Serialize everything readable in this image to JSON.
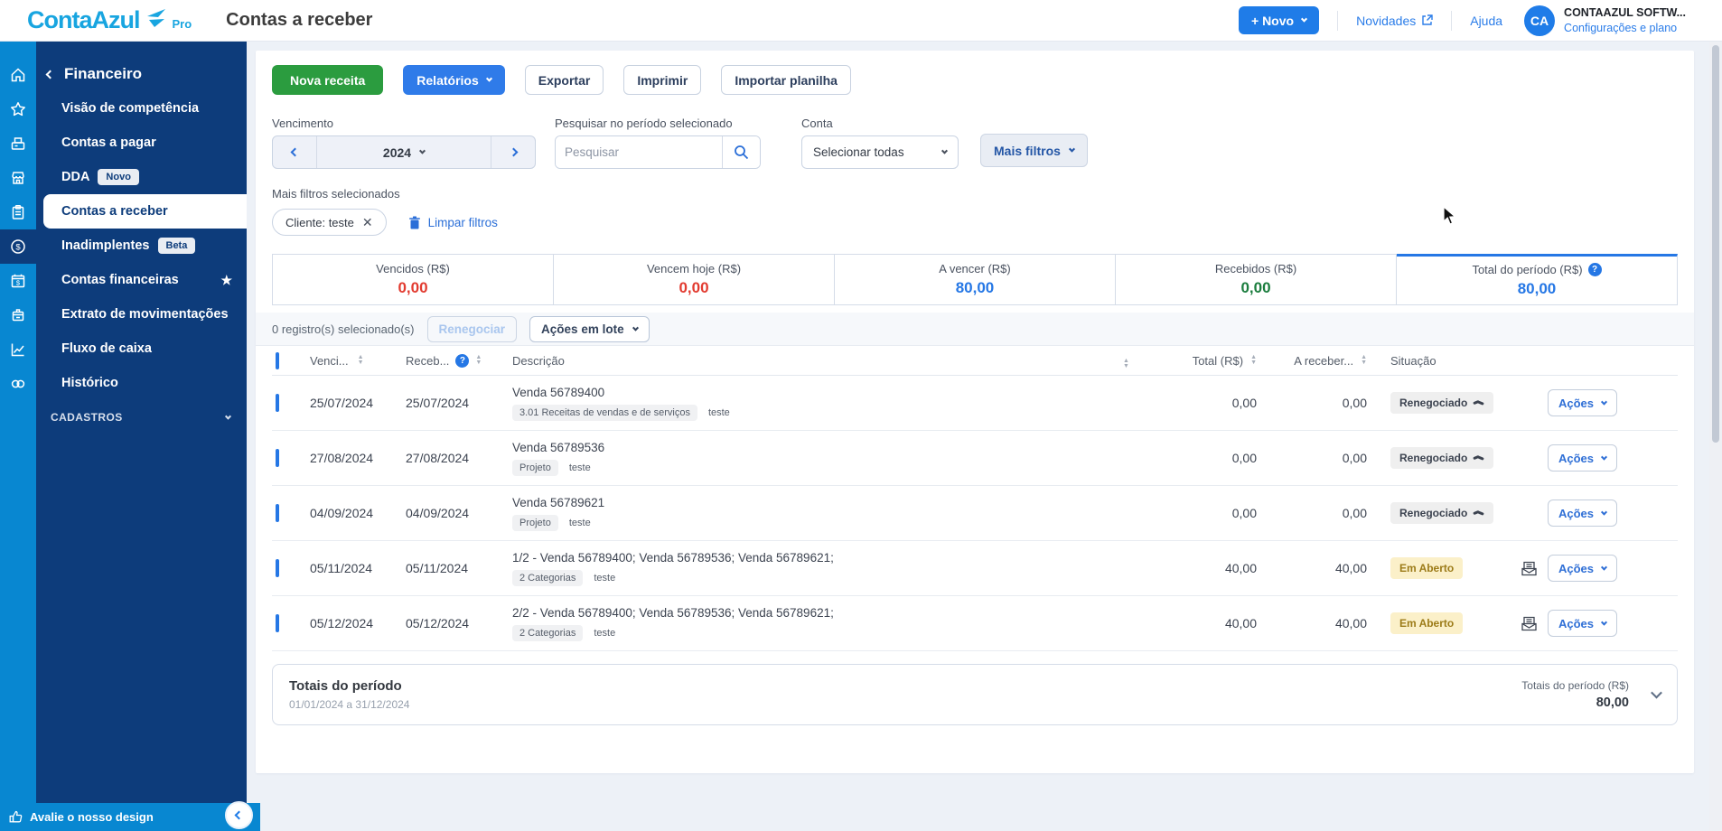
{
  "colors": {
    "brand_cyan": "#18a5e0",
    "rail_blue": "#0887d1",
    "sidebar_navy": "#0d3c7b",
    "accent_blue": "#1f7ce8",
    "green_button": "#2b9c3f",
    "value_red": "#e23b30",
    "value_blue": "#2577e5",
    "value_green": "#1b7d3e",
    "warning_badge_bg": "#fbf0c9"
  },
  "header": {
    "logo_text": "ContaAzul",
    "logo_pro": "Pro",
    "page_title": "Contas a receber",
    "novo_button": "+ Novo",
    "novidades_link": "Novidades",
    "ajuda_link": "Ajuda",
    "avatar_initials": "CA",
    "account_name": "CONTAAZUL SOFTW...",
    "account_settings": "Configurações e plano"
  },
  "sidebar": {
    "section_title": "Financeiro",
    "items": [
      {
        "label": "Visão de competência"
      },
      {
        "label": "Contas a pagar"
      },
      {
        "label": "DDA",
        "badge": "Novo"
      },
      {
        "label": "Contas a receber"
      },
      {
        "label": "Inadimplentes",
        "badge": "Beta"
      },
      {
        "label": "Contas financeiras"
      },
      {
        "label": "Extrato de movimentações"
      },
      {
        "label": "Fluxo de caixa"
      },
      {
        "label": "Histórico"
      }
    ],
    "section_footer": "CADASTROS",
    "rate_design": "Avalie o nosso design"
  },
  "toolbar": {
    "nova_receita": "Nova receita",
    "relatorios": "Relatórios",
    "exportar": "Exportar",
    "imprimir": "Imprimir",
    "importar_planilha": "Importar planilha"
  },
  "filters": {
    "vencimento_label": "Vencimento",
    "year_value": "2024",
    "search_label": "Pesquisar no período selecionado",
    "search_placeholder": "Pesquisar",
    "conta_label": "Conta",
    "conta_value": "Selecionar todas",
    "mais_filtros": "Mais filtros",
    "selected_label": "Mais filtros selecionados",
    "chip": "Cliente: teste",
    "limpar_filtros": "Limpar filtros"
  },
  "summary_cards": [
    {
      "label": "Vencidos (R$)",
      "value": "0,00",
      "color": "#e23b30"
    },
    {
      "label": "Vencem hoje (R$)",
      "value": "0,00",
      "color": "#e23b30"
    },
    {
      "label": "A vencer (R$)",
      "value": "80,00",
      "color": "#2577e5"
    },
    {
      "label": "Recebidos (R$)",
      "value": "0,00",
      "color": "#1b7d3e"
    },
    {
      "label": "Total do período (R$)",
      "value": "80,00",
      "color": "#2577e5"
    }
  ],
  "batch_bar": {
    "selected_text": "0 registro(s) selecionado(s)",
    "renegociar": "Renegociar",
    "acoes_em_lote": "Ações em lote"
  },
  "table": {
    "columns": {
      "venc": "Venci...",
      "receb": "Receb...",
      "descricao": "Descrição",
      "total": "Total (R$)",
      "a_receber": "A receber...",
      "situacao": "Situação"
    },
    "acoes_label": "Ações",
    "rows": [
      {
        "venc": "25/07/2024",
        "receb": "25/07/2024",
        "desc": "Venda 56789400",
        "tag": "3.01 Receitas de vendas e de serviços",
        "tag_extra": "teste",
        "total": "0,00",
        "a_receber": "0,00",
        "status": "Renegociado",
        "status_type": "renegociado",
        "boleto": false
      },
      {
        "venc": "27/08/2024",
        "receb": "27/08/2024",
        "desc": "Venda 56789536",
        "tag": "Projeto",
        "tag_extra": "teste",
        "total": "0,00",
        "a_receber": "0,00",
        "status": "Renegociado",
        "status_type": "renegociado",
        "boleto": false
      },
      {
        "venc": "04/09/2024",
        "receb": "04/09/2024",
        "desc": "Venda 56789621",
        "tag": "Projeto",
        "tag_extra": "teste",
        "total": "0,00",
        "a_receber": "0,00",
        "status": "Renegociado",
        "status_type": "renegociado",
        "boleto": false
      },
      {
        "venc": "05/11/2024",
        "receb": "05/11/2024",
        "desc": "1/2 - Venda 56789400; Venda 56789536; Venda 56789621;",
        "tag": "2 Categorias",
        "tag_extra": "teste",
        "total": "40,00",
        "a_receber": "40,00",
        "status": "Em Aberto",
        "status_type": "em-aberto",
        "boleto": true
      },
      {
        "venc": "05/12/2024",
        "receb": "05/12/2024",
        "desc": "2/2 - Venda 56789400; Venda 56789536; Venda 56789621;",
        "tag": "2 Categorias",
        "tag_extra": "teste",
        "total": "40,00",
        "a_receber": "40,00",
        "status": "Em Aberto",
        "status_type": "em-aberto",
        "boleto": true
      }
    ]
  },
  "totals_footer": {
    "title": "Totais do período",
    "period": "01/01/2024 a 31/12/2024",
    "right_label": "Totais do período (R$)",
    "right_value": "80,00"
  }
}
